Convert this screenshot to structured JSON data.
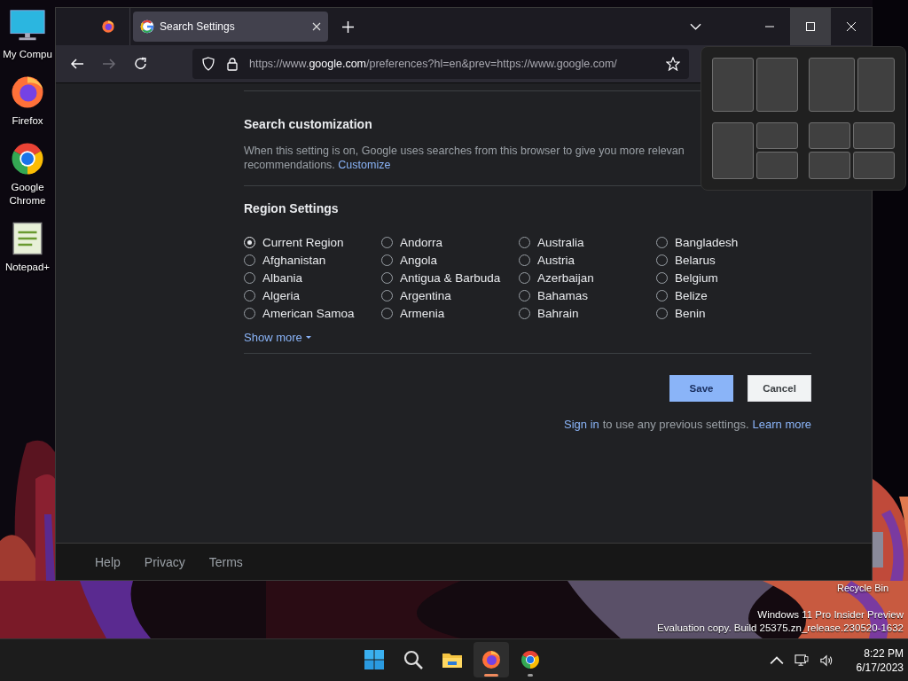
{
  "desktop_icons": [
    {
      "kind": "monitor",
      "label": "My Compu"
    },
    {
      "kind": "firefox",
      "label": "Firefox"
    },
    {
      "kind": "chrome",
      "label": "Google Chrome"
    },
    {
      "kind": "notepad",
      "label": "Notepad+"
    }
  ],
  "recycle_bin": {
    "label": "Recycle Bin"
  },
  "browser": {
    "tabs": [
      {
        "kind": "firefox-view",
        "selected": false
      },
      {
        "kind": "page",
        "title": "Search Settings",
        "selected": true
      }
    ],
    "window_buttons": [
      {
        "kind": "minimize",
        "hovered": false
      },
      {
        "kind": "maximize",
        "hovered": true
      },
      {
        "kind": "close",
        "hovered": false
      }
    ],
    "url": {
      "scheme": "https://www.",
      "domain": "google.com",
      "rest": "/preferences?hl=en&prev=https://www.google.com/"
    },
    "page": {
      "search_customization": {
        "heading": "Search customization",
        "text_line_1": "When this setting is on, Google uses searches from this browser to give you more relevan",
        "text_line_2": "recommendations.",
        "link": "Customize"
      },
      "region": {
        "heading": "Region Settings",
        "options": [
          {
            "label": "Current Region",
            "selected": true
          },
          {
            "label": "Afghanistan",
            "selected": false
          },
          {
            "label": "Albania",
            "selected": false
          },
          {
            "label": "Algeria",
            "selected": false
          },
          {
            "label": "American Samoa",
            "selected": false
          },
          {
            "label": "Andorra",
            "selected": false
          },
          {
            "label": "Angola",
            "selected": false
          },
          {
            "label": "Antigua & Barbuda",
            "selected": false
          },
          {
            "label": "Argentina",
            "selected": false
          },
          {
            "label": "Armenia",
            "selected": false
          },
          {
            "label": "Australia",
            "selected": false
          },
          {
            "label": "Austria",
            "selected": false
          },
          {
            "label": "Azerbaijan",
            "selected": false
          },
          {
            "label": "Bahamas",
            "selected": false
          },
          {
            "label": "Bahrain",
            "selected": false
          },
          {
            "label": "Bangladesh",
            "selected": false
          },
          {
            "label": "Belarus",
            "selected": false
          },
          {
            "label": "Belgium",
            "selected": false
          },
          {
            "label": "Belize",
            "selected": false
          },
          {
            "label": "Benin",
            "selected": false
          }
        ],
        "show_more": "Show more"
      },
      "buttons": [
        {
          "kind": "primary",
          "label": "Save"
        },
        {
          "kind": "secondary",
          "label": "Cancel"
        }
      ],
      "sign_in": {
        "link": "Sign in",
        "text": "to use any previous settings.",
        "learn_more": "Learn more"
      },
      "footer_links": [
        "Help",
        "Privacy",
        "Terms"
      ]
    }
  },
  "snap_layouts": [
    {
      "kind": "halves"
    },
    {
      "kind": "wide-narrow"
    },
    {
      "kind": "half-quarters"
    },
    {
      "kind": "quarters"
    }
  ],
  "watermark": [
    "Windows 11 Pro Insider Preview",
    "Evaluation copy. Build 25375.zn_release.230520-1632"
  ],
  "taskbar": {
    "apps": [
      {
        "kind": "start",
        "active": false,
        "running": false
      },
      {
        "kind": "search",
        "active": false,
        "running": false
      },
      {
        "kind": "explorer",
        "active": false,
        "running": false
      },
      {
        "kind": "firefox",
        "active": true,
        "running": true
      },
      {
        "kind": "chrome",
        "active": false,
        "running": true
      }
    ],
    "time": "8:22 PM",
    "date": "6/17/2023"
  }
}
